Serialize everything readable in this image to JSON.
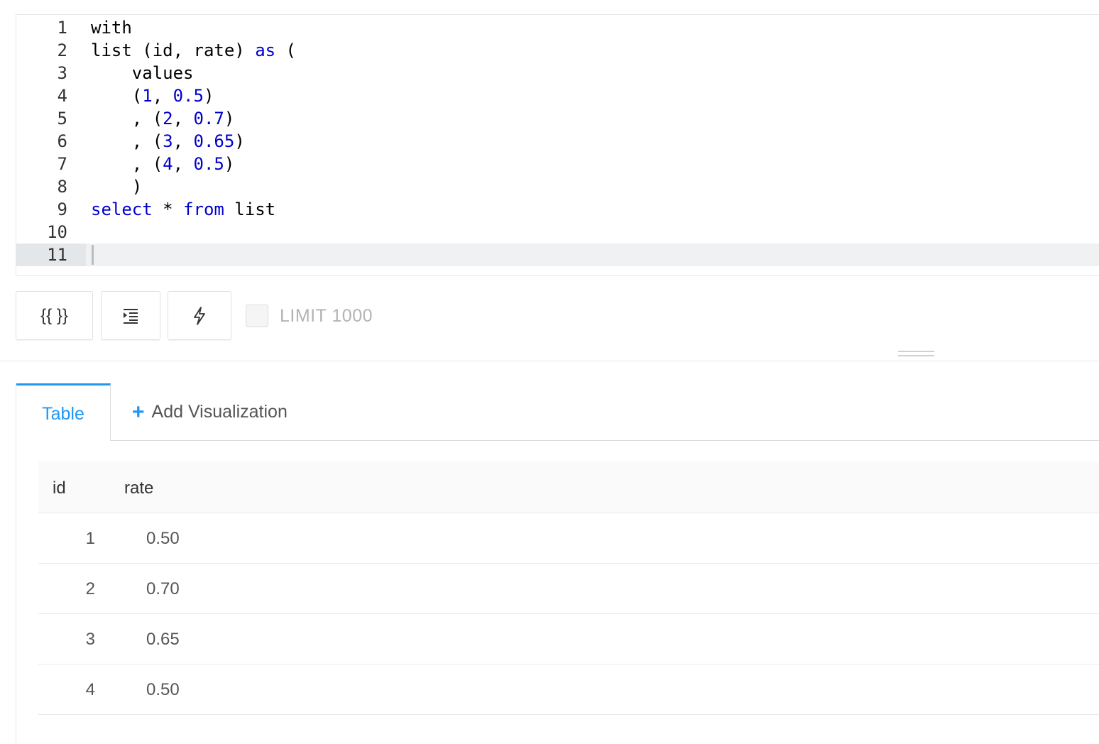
{
  "editor": {
    "lines": [
      {
        "num": "1",
        "tokens": [
          {
            "t": "with",
            "c": "txt"
          }
        ]
      },
      {
        "num": "2",
        "tokens": [
          {
            "t": "list (id, rate) ",
            "c": "txt"
          },
          {
            "t": "as",
            "c": "kw"
          },
          {
            "t": " (",
            "c": "txt"
          }
        ]
      },
      {
        "num": "3",
        "tokens": [
          {
            "t": "    values",
            "c": "txt"
          }
        ]
      },
      {
        "num": "4",
        "tokens": [
          {
            "t": "    (",
            "c": "txt"
          },
          {
            "t": "1",
            "c": "numlit"
          },
          {
            "t": ", ",
            "c": "txt"
          },
          {
            "t": "0.5",
            "c": "numlit"
          },
          {
            "t": ")",
            "c": "txt"
          }
        ]
      },
      {
        "num": "5",
        "tokens": [
          {
            "t": "    , (",
            "c": "txt"
          },
          {
            "t": "2",
            "c": "numlit"
          },
          {
            "t": ", ",
            "c": "txt"
          },
          {
            "t": "0.7",
            "c": "numlit"
          },
          {
            "t": ")",
            "c": "txt"
          }
        ]
      },
      {
        "num": "6",
        "tokens": [
          {
            "t": "    , (",
            "c": "txt"
          },
          {
            "t": "3",
            "c": "numlit"
          },
          {
            "t": ", ",
            "c": "txt"
          },
          {
            "t": "0.65",
            "c": "numlit"
          },
          {
            "t": ")",
            "c": "txt"
          }
        ]
      },
      {
        "num": "7",
        "tokens": [
          {
            "t": "    , (",
            "c": "txt"
          },
          {
            "t": "4",
            "c": "numlit"
          },
          {
            "t": ", ",
            "c": "txt"
          },
          {
            "t": "0.5",
            "c": "numlit"
          },
          {
            "t": ")",
            "c": "txt"
          }
        ]
      },
      {
        "num": "8",
        "tokens": [
          {
            "t": "    )",
            "c": "txt"
          }
        ]
      },
      {
        "num": "9",
        "tokens": [
          {
            "t": "select",
            "c": "kw"
          },
          {
            "t": " * ",
            "c": "txt"
          },
          {
            "t": "from",
            "c": "kw"
          },
          {
            "t": " list",
            "c": "txt"
          }
        ]
      },
      {
        "num": "10",
        "tokens": []
      },
      {
        "num": "11",
        "tokens": [],
        "active": true
      }
    ]
  },
  "toolbar": {
    "params_label": "{{ }}",
    "format_icon": "indent-icon",
    "autocomplete_icon": "lightning-icon",
    "limit_label": "LIMIT 1000",
    "limit_checked": false
  },
  "tabs": {
    "table_label": "Table",
    "add_label": "Add Visualization"
  },
  "table": {
    "columns": [
      "id",
      "rate"
    ],
    "rows": [
      [
        "1",
        "0.50"
      ],
      [
        "2",
        "0.70"
      ],
      [
        "3",
        "0.65"
      ],
      [
        "4",
        "0.50"
      ]
    ]
  },
  "colors": {
    "accent": "#2196f3",
    "keyword": "#0000cc"
  }
}
